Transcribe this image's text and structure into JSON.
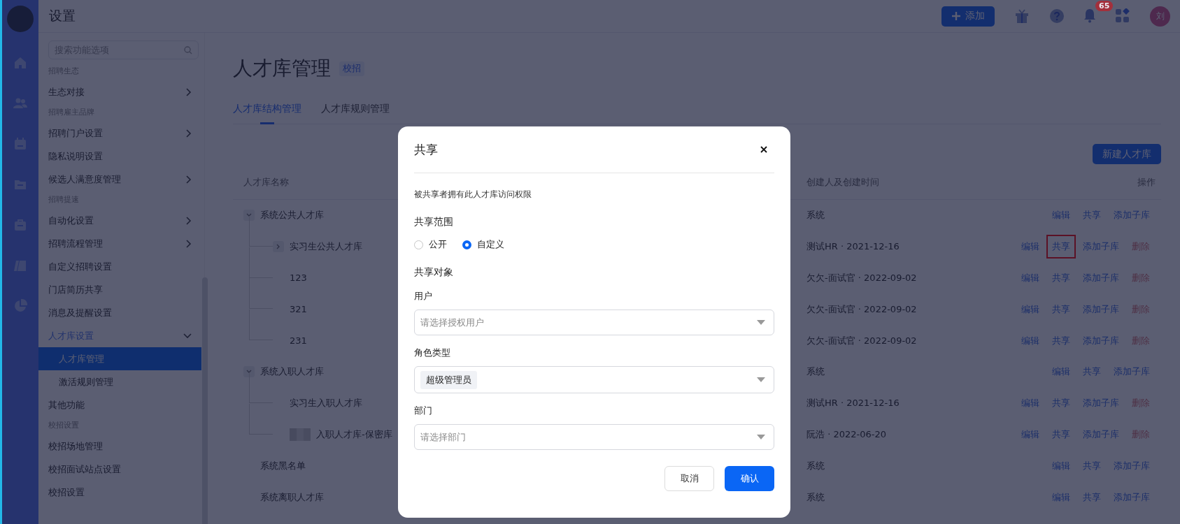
{
  "header": {
    "title": "设置",
    "add_button": "添加",
    "notification_count": "65",
    "avatar_initial": "刘"
  },
  "sidebar": {
    "search": {
      "placeholder": "搜索功能选项"
    },
    "items": [
      {
        "kind": "section",
        "label": "招聘生态"
      },
      {
        "kind": "item",
        "label": "生态对接",
        "expandable": true,
        "expanded": false,
        "selected": false
      },
      {
        "kind": "section",
        "label": "招聘雇主品牌"
      },
      {
        "kind": "item",
        "label": "招聘门户设置",
        "expandable": true,
        "expanded": false,
        "selected": false
      },
      {
        "kind": "item",
        "label": "隐私说明设置",
        "expandable": false,
        "expanded": false,
        "selected": false
      },
      {
        "kind": "item",
        "label": "候选人满意度管理",
        "expandable": true,
        "expanded": false,
        "selected": false
      },
      {
        "kind": "section",
        "label": "招聘提速"
      },
      {
        "kind": "item",
        "label": "自动化设置",
        "expandable": true,
        "expanded": false,
        "selected": false
      },
      {
        "kind": "item",
        "label": "招聘流程管理",
        "expandable": true,
        "expanded": false,
        "selected": false
      },
      {
        "kind": "item",
        "label": "自定义招聘设置",
        "expandable": false,
        "expanded": false,
        "selected": false
      },
      {
        "kind": "item",
        "label": "门店简历共享",
        "expandable": false,
        "expanded": false,
        "selected": false
      },
      {
        "kind": "item",
        "label": "消息及提醒设置",
        "expandable": false,
        "expanded": false,
        "selected": false
      },
      {
        "kind": "item",
        "label": "人才库设置",
        "expandable": true,
        "expanded": true,
        "selected": false
      },
      {
        "kind": "subitem",
        "label": "人才库管理",
        "expandable": false,
        "expanded": false,
        "selected": true
      },
      {
        "kind": "subitem",
        "label": "激活规则管理",
        "expandable": false,
        "expanded": false,
        "selected": false
      },
      {
        "kind": "item",
        "label": "其他功能",
        "expandable": false,
        "expanded": false,
        "selected": false
      },
      {
        "kind": "section",
        "label": "校招设置"
      },
      {
        "kind": "item",
        "label": "校招场地管理",
        "expandable": false,
        "expanded": false,
        "selected": false
      },
      {
        "kind": "item",
        "label": "校招面试站点设置",
        "expandable": false,
        "expanded": false,
        "selected": false
      },
      {
        "kind": "item",
        "label": "校招设置",
        "expandable": false,
        "expanded": false,
        "selected": false
      }
    ]
  },
  "page": {
    "title": "人才库管理",
    "tag": "校招",
    "tabs": [
      {
        "label": "人才库结构管理",
        "selected": true
      },
      {
        "label": "人才库规则管理",
        "selected": false
      }
    ],
    "new_button": "新建人才库"
  },
  "table": {
    "columns": [
      "人才库名称",
      "创建人及创建时间",
      "操作"
    ],
    "rows": [
      {
        "name": "系统公共人才库",
        "creator": "系统",
        "expanded": true,
        "actions": [
          {
            "label": "编辑",
            "kind": "link",
            "highlighted": false
          },
          {
            "label": "共享",
            "kind": "link",
            "highlighted": false
          },
          {
            "label": "添加子库",
            "kind": "link",
            "highlighted": false
          }
        ],
        "children": [
          {
            "name": "实习生公共人才库",
            "creator": "测试HR · 2021-12-16",
            "expanded": false,
            "actions": [
              {
                "label": "编辑",
                "kind": "link",
                "highlighted": false
              },
              {
                "label": "共享",
                "kind": "link",
                "highlighted": true
              },
              {
                "label": "添加子库",
                "kind": "link",
                "highlighted": false
              },
              {
                "label": "删除",
                "kind": "danger",
                "highlighted": false
              }
            ]
          },
          {
            "name": "123",
            "creator": "欠欠-面试官 · 2022-09-02",
            "actions": [
              {
                "label": "编辑",
                "kind": "link",
                "highlighted": false
              },
              {
                "label": "共享",
                "kind": "link",
                "highlighted": false
              },
              {
                "label": "添加子库",
                "kind": "link",
                "highlighted": false
              },
              {
                "label": "删除",
                "kind": "danger",
                "highlighted": false
              }
            ]
          },
          {
            "name": "321",
            "creator": "欠欠-面试官 · 2022-09-02",
            "actions": [
              {
                "label": "编辑",
                "kind": "link",
                "highlighted": false
              },
              {
                "label": "共享",
                "kind": "link",
                "highlighted": false
              },
              {
                "label": "添加子库",
                "kind": "link",
                "highlighted": false
              },
              {
                "label": "删除",
                "kind": "danger",
                "highlighted": false
              }
            ]
          },
          {
            "name": "231",
            "creator": "欠欠-面试官 · 2022-09-02",
            "actions": [
              {
                "label": "编辑",
                "kind": "link",
                "highlighted": false
              },
              {
                "label": "共享",
                "kind": "link",
                "highlighted": false
              },
              {
                "label": "添加子库",
                "kind": "link",
                "highlighted": false
              },
              {
                "label": "删除",
                "kind": "danger",
                "highlighted": false
              }
            ]
          }
        ]
      },
      {
        "name": "系统入职人才库",
        "creator": "系统",
        "expanded": true,
        "actions": [
          {
            "label": "编辑",
            "kind": "link",
            "highlighted": false
          },
          {
            "label": "共享",
            "kind": "link",
            "highlighted": false
          },
          {
            "label": "添加子库",
            "kind": "link",
            "highlighted": false
          }
        ],
        "children": [
          {
            "name": "实习生入职人才库",
            "creator": "测试HR · 2021-12-16",
            "actions": [
              {
                "label": "编辑",
                "kind": "link",
                "highlighted": false
              },
              {
                "label": "共享",
                "kind": "link",
                "highlighted": false
              },
              {
                "label": "添加子库",
                "kind": "link",
                "highlighted": false
              },
              {
                "label": "删除",
                "kind": "danger",
                "highlighted": false
              }
            ]
          },
          {
            "name": "入职人才库-保密库",
            "redacted": true,
            "creator": "阮浩 · 2022-06-20",
            "actions": [
              {
                "label": "编辑",
                "kind": "link",
                "highlighted": false
              },
              {
                "label": "共享",
                "kind": "link",
                "highlighted": false
              },
              {
                "label": "添加子库",
                "kind": "link",
                "highlighted": false
              },
              {
                "label": "删除",
                "kind": "danger",
                "highlighted": false
              }
            ]
          }
        ]
      },
      {
        "name": "系统黑名单",
        "creator": "系统",
        "actions": [
          {
            "label": "编辑",
            "kind": "link",
            "highlighted": false
          },
          {
            "label": "共享",
            "kind": "link",
            "highlighted": false
          },
          {
            "label": "添加子库",
            "kind": "link",
            "highlighted": false
          }
        ]
      },
      {
        "name": "系统离职人才库",
        "creator": "系统",
        "actions": [
          {
            "label": "编辑",
            "kind": "link",
            "highlighted": false
          },
          {
            "label": "共享",
            "kind": "link",
            "highlighted": false
          },
          {
            "label": "添加子库",
            "kind": "link",
            "highlighted": false
          }
        ]
      }
    ]
  },
  "dialog": {
    "title": "共享",
    "description": "被共享者拥有此人才库访问权限",
    "scope_label": "共享范围",
    "scope_options": [
      {
        "label": "公开",
        "selected": false
      },
      {
        "label": "自定义",
        "selected": true
      }
    ],
    "target_label": "共享对象",
    "fields": [
      {
        "label": "用户",
        "placeholder": "请选择授权用户"
      },
      {
        "label": "角色类型",
        "tags": [
          "超级管理员"
        ]
      },
      {
        "label": "部门",
        "placeholder": "请选择部门"
      }
    ],
    "cancel": "取消",
    "confirm": "确认"
  }
}
